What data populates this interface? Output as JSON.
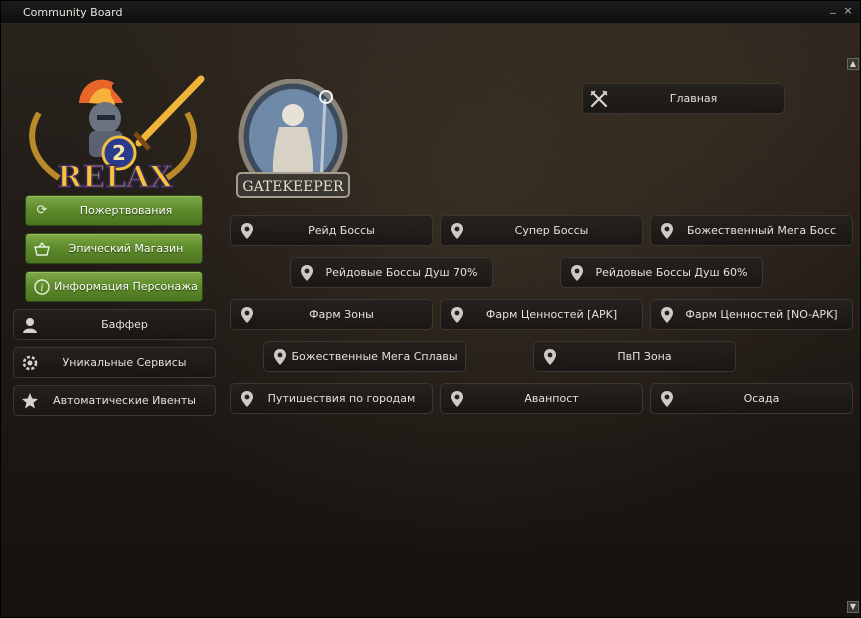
{
  "window": {
    "title": "Community Board",
    "minimize_glyph": "_",
    "close_glyph": "×"
  },
  "scroll": {
    "up_glyph": "▲",
    "down_glyph": "▼"
  },
  "logo": {
    "number": "2",
    "word": "RELAX"
  },
  "gatekeeper": {
    "caption": "GATEKEEPER"
  },
  "left_menu": {
    "green": [
      {
        "label": "Пожертвования",
        "icon": "refresh-icon"
      },
      {
        "label": "Эпический Магазин",
        "icon": "basket-icon"
      },
      {
        "label": "Информация Персонажа",
        "icon": "info-icon"
      }
    ],
    "dark": [
      {
        "label": "Баффер",
        "icon": "user-icon"
      },
      {
        "label": "Уникальные Сервисы",
        "icon": "gear-icon"
      },
      {
        "label": "Автоматические Ивенты",
        "icon": "star-icon"
      }
    ]
  },
  "main_button": {
    "label": "Главная",
    "icon": "crossed-swords-icon"
  },
  "teleports": [
    {
      "label": "Рейд Боссы",
      "icon": "map-pin-icon"
    },
    {
      "label": "Супер Боссы",
      "icon": "map-pin-icon"
    },
    {
      "label": "Божественный Мега Босс",
      "icon": "map-pin-icon"
    },
    {
      "label": "Рейдовые Боссы Душ 70%",
      "icon": "map-pin-icon"
    },
    {
      "label": "Рейдовые Боссы Душ 60%",
      "icon": "map-pin-icon"
    },
    {
      "label": "Фарм Зоны",
      "icon": "map-pin-icon"
    },
    {
      "label": "Фарм Ценностей [APK]",
      "icon": "map-pin-icon"
    },
    {
      "label": "Фарм Ценностей [NO-APK]",
      "icon": "map-pin-icon"
    },
    {
      "label": "Божественные Мега Сплавы",
      "icon": "map-pin-icon"
    },
    {
      "label": "ПвП Зона",
      "icon": "map-pin-icon"
    },
    {
      "label": "Путишествия по городам",
      "icon": "map-pin-icon"
    },
    {
      "label": "Аванпост",
      "icon": "map-pin-icon"
    },
    {
      "label": "Осада",
      "icon": "map-pin-icon"
    }
  ]
}
